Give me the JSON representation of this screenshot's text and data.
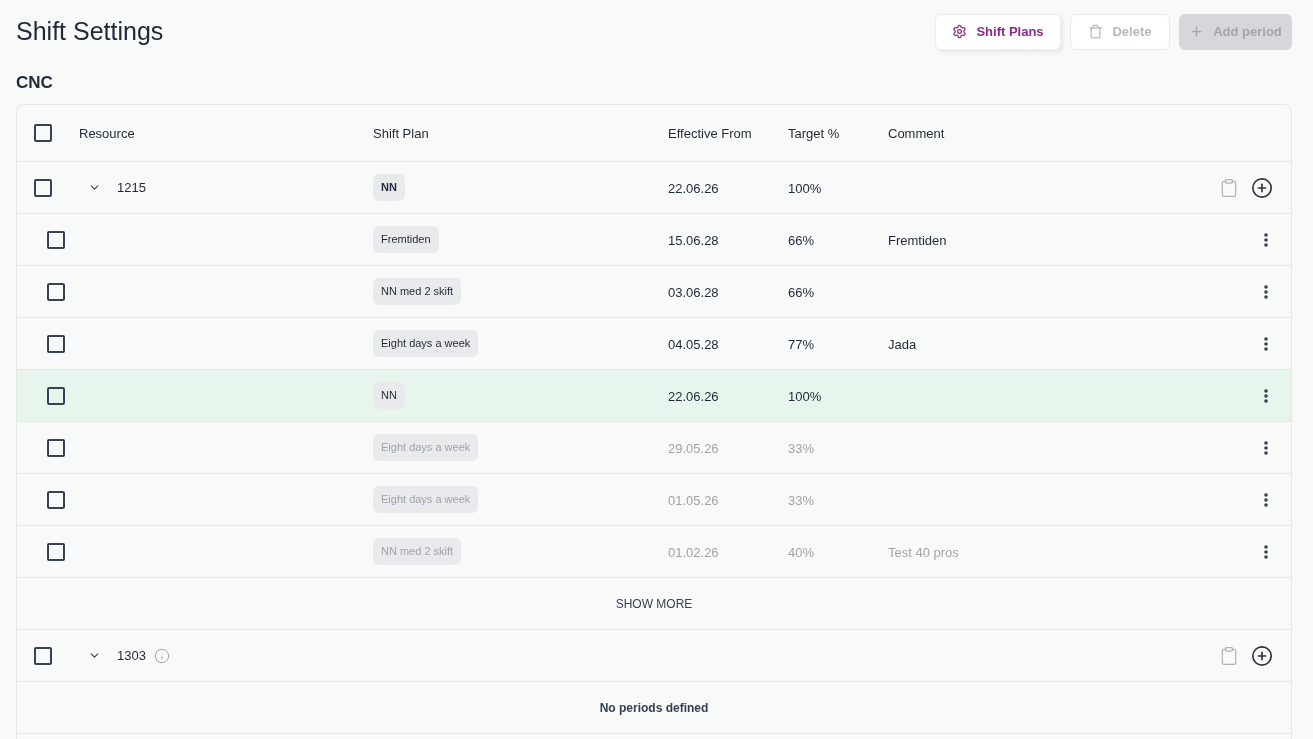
{
  "page": {
    "title": "Shift Settings",
    "section": "CNC"
  },
  "toolbar": [
    {
      "kind": "plans",
      "label": "Shift Plans",
      "disabled": false
    },
    {
      "kind": "delete",
      "label": "Delete",
      "disabled": true
    },
    {
      "kind": "add",
      "label": "Add period",
      "disabled": true
    }
  ],
  "table": {
    "select_all": {
      "checked": false
    },
    "columns": [
      "Resource",
      "Shift Plan",
      "Effective From",
      "Target %",
      "Comment"
    ],
    "groups": [
      {
        "resource": "1215",
        "expanded": true,
        "checked": false,
        "info": false,
        "plan": "NN",
        "effective_from": "22.06.26",
        "target": "100%",
        "periods": [
          {
            "plan": "Fremtiden",
            "effective_from": "15.06.28",
            "target": "66%",
            "comment": "Fremtiden",
            "current": false,
            "expired": false,
            "checked": false
          },
          {
            "plan": "NN med 2 skift",
            "effective_from": "03.06.28",
            "target": "66%",
            "current": false,
            "expired": false,
            "checked": false
          },
          {
            "plan": "Eight days a week",
            "effective_from": "04.05.28",
            "target": "77%",
            "comment": "Jada",
            "current": false,
            "expired": false,
            "checked": false
          },
          {
            "plan": "NN",
            "effective_from": "22.06.26",
            "target": "100%",
            "current": true,
            "expired": false,
            "checked": false
          },
          {
            "plan": "Eight days a week",
            "effective_from": "29.05.26",
            "target": "33%",
            "current": false,
            "expired": true,
            "checked": false
          },
          {
            "plan": "Eight days a week",
            "effective_from": "01.05.26",
            "target": "33%",
            "current": false,
            "expired": true,
            "checked": false
          },
          {
            "plan": "NN med 2 skift",
            "effective_from": "01.02.26",
            "target": "40%",
            "comment": "Test 40 pros",
            "current": false,
            "expired": true,
            "checked": false
          }
        ],
        "show_more": "SHOW MORE"
      },
      {
        "resource": "1303",
        "expanded": true,
        "checked": false,
        "info": true,
        "empty_message": "No periods defined"
      }
    ]
  }
}
